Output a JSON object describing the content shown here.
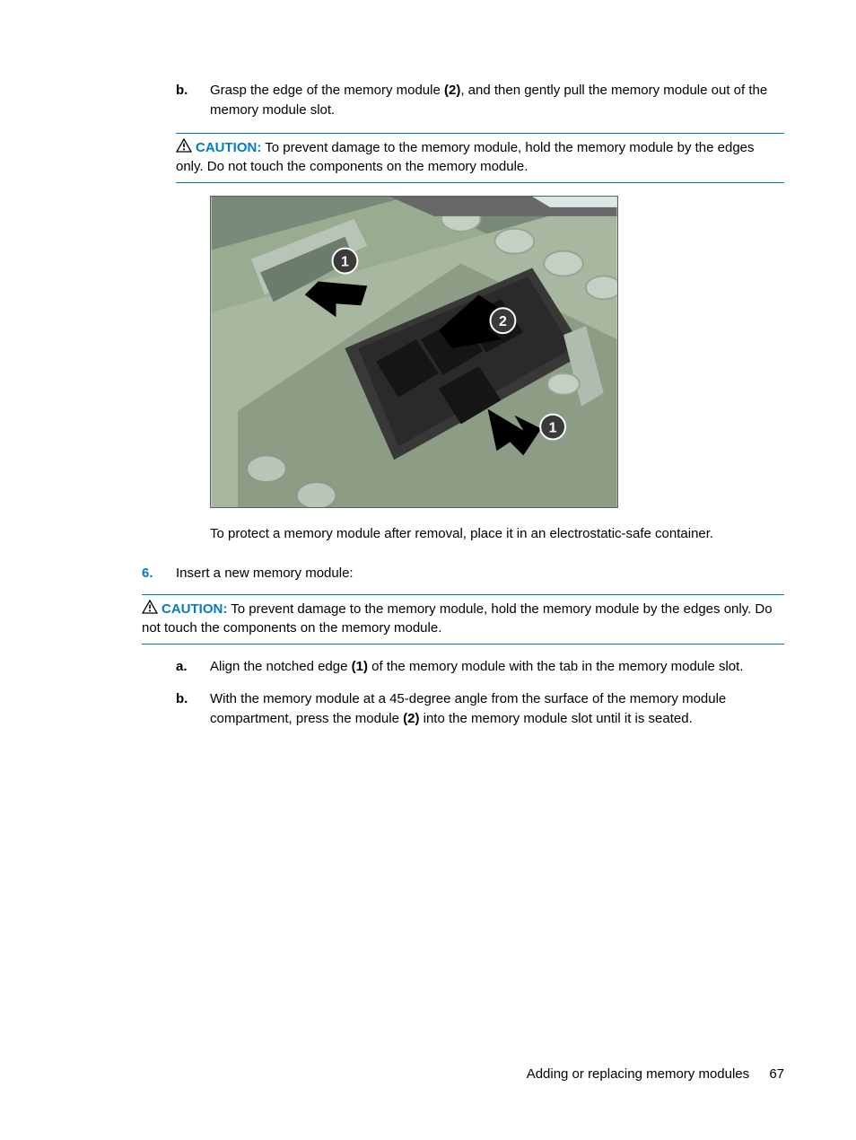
{
  "step_b": {
    "marker": "b.",
    "text_1": "Grasp the edge of the memory module ",
    "bold_1": "(2)",
    "text_2": ", and then gently pull the memory module out of the memory module slot."
  },
  "caution1": {
    "label": "CAUTION:",
    "text": " To prevent damage to the memory module, hold the memory module by the edges only. Do not touch the components on the memory module."
  },
  "protect_text": "To protect a memory module after removal, place it in an electrostatic-safe container.",
  "step6": {
    "marker": "6.",
    "text": "Insert a new memory module:"
  },
  "caution2": {
    "label": "CAUTION:",
    "text": " To prevent damage to the memory module, hold the memory module by the edges only. Do not touch the components on the memory module."
  },
  "sub_a": {
    "marker": "a.",
    "t1": "Align the notched edge ",
    "b1": "(1)",
    "t2": " of the memory module with the tab in the memory module slot."
  },
  "sub_b": {
    "marker": "b.",
    "t1": "With the memory module at a 45-degree angle from the surface of the memory module compartment, press the module ",
    "b1": "(2)",
    "t2": " into the memory module slot until it is seated."
  },
  "footer": {
    "section": "Adding or replacing memory modules",
    "page": "67"
  }
}
